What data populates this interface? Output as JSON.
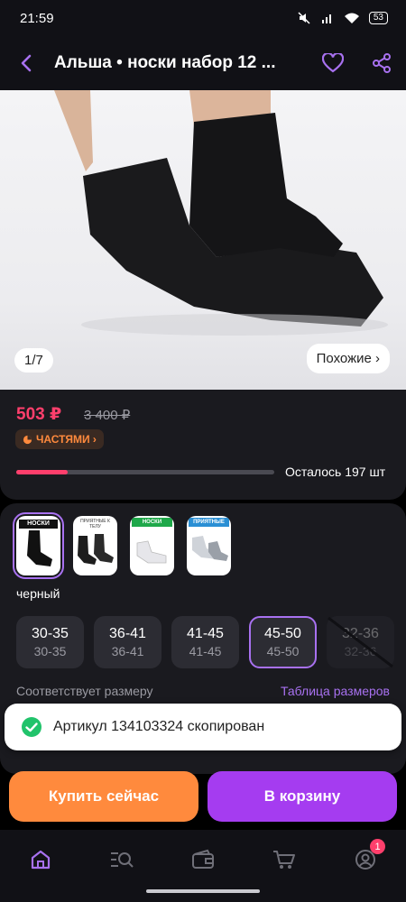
{
  "status_bar": {
    "time": "21:59",
    "battery": "53"
  },
  "header": {
    "title": "Альша • носки набор 12 ..."
  },
  "gallery": {
    "counter_current": "1",
    "counter_sep": "/",
    "counter_total": "7",
    "similar_label": "Похожие ›"
  },
  "price": {
    "current": "503 ₽",
    "old": "3 400 ₽",
    "installment_label": "ЧАСТЯМИ ›",
    "stock_text": "Осталось 197 шт",
    "stock_fraction": 0.2
  },
  "options": {
    "color_label": "черный",
    "thumbs": [
      {
        "caption": "НОСКИ"
      },
      {
        "caption": "ПРИЯТНЫЕ К ТЕЛУ"
      },
      {
        "caption": "НОСКИ"
      },
      {
        "caption": "ПРИЯТНЫЕ"
      }
    ],
    "sizes": [
      {
        "main": "30-35",
        "sub": "30-35"
      },
      {
        "main": "36-41",
        "sub": "36-41"
      },
      {
        "main": "41-45",
        "sub": "41-45"
      },
      {
        "main": "45-50",
        "sub": "45-50"
      },
      {
        "main": "32-36",
        "sub": "32-36"
      }
    ],
    "fit_text": "Соответствует размеру",
    "size_table_link": "Таблица размеров"
  },
  "toast": {
    "message": "Артикул 134103324 скопирован"
  },
  "actions": {
    "buy_now": "Купить сейчас",
    "add_to_cart": "В корзину"
  },
  "nav": {
    "profile_badge": "1"
  },
  "colors": {
    "accent": "#a871f0",
    "price": "#ff3f6c",
    "buy": "#ff8a3d",
    "cart": "#a53cf0",
    "success": "#21c36b"
  }
}
